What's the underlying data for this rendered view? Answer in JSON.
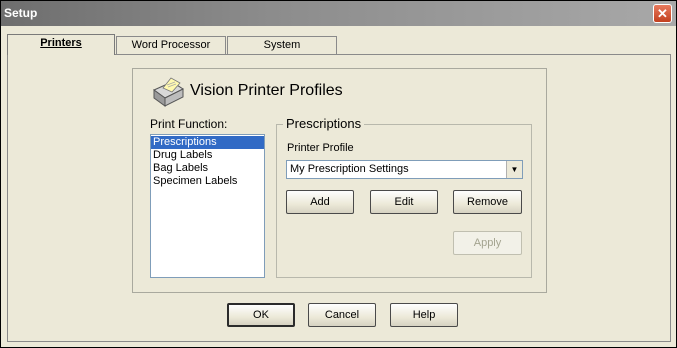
{
  "window": {
    "title": "Setup",
    "close_glyph": "✕"
  },
  "tabs": [
    {
      "label": "Printers",
      "active": true
    },
    {
      "label": "Word Processor",
      "active": false
    },
    {
      "label": "System",
      "active": false
    }
  ],
  "panel": {
    "title": "Vision Printer Profiles",
    "icon": "printer-icon",
    "print_function_label": "Print Function:",
    "print_functions": [
      "Prescriptions",
      "Drug Labels",
      "Bag Labels",
      "Specimen Labels"
    ],
    "selected_function": "Prescriptions",
    "group_legend": "Prescriptions",
    "printer_profile_label": "Printer Profile",
    "printer_profile_value": "My Prescription Settings",
    "buttons": {
      "add": "Add",
      "edit": "Edit",
      "remove": "Remove",
      "apply": "Apply"
    }
  },
  "dialog_buttons": {
    "ok": "OK",
    "cancel": "Cancel",
    "help": "Help"
  },
  "colors": {
    "selection": "#316ac5",
    "dialog_bg": "#ece9d8",
    "titlebar": "#8c8c8c",
    "close_button": "#d1552f"
  }
}
